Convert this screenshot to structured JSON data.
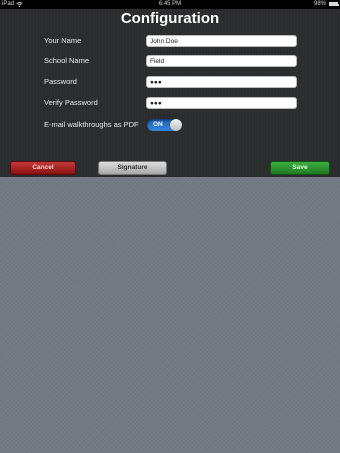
{
  "status_bar": {
    "carrier": "iPad",
    "time": "6:45 PM",
    "battery": "98%",
    "battery_level": 0.98
  },
  "page": {
    "title": "Configuration"
  },
  "form": {
    "your_name": {
      "label": "Your Name",
      "value": "John Doe"
    },
    "school_name": {
      "label": "School Name",
      "value": "Field"
    },
    "password": {
      "label": "Password",
      "value": "●●●"
    },
    "verify_password": {
      "label": "Verify Password",
      "value": "●●●"
    },
    "email_pdf": {
      "label": "E-mail walkthroughs as PDF",
      "state": "ON"
    }
  },
  "buttons": {
    "cancel": "Cancel",
    "signature": "Signature",
    "save": "Save"
  }
}
